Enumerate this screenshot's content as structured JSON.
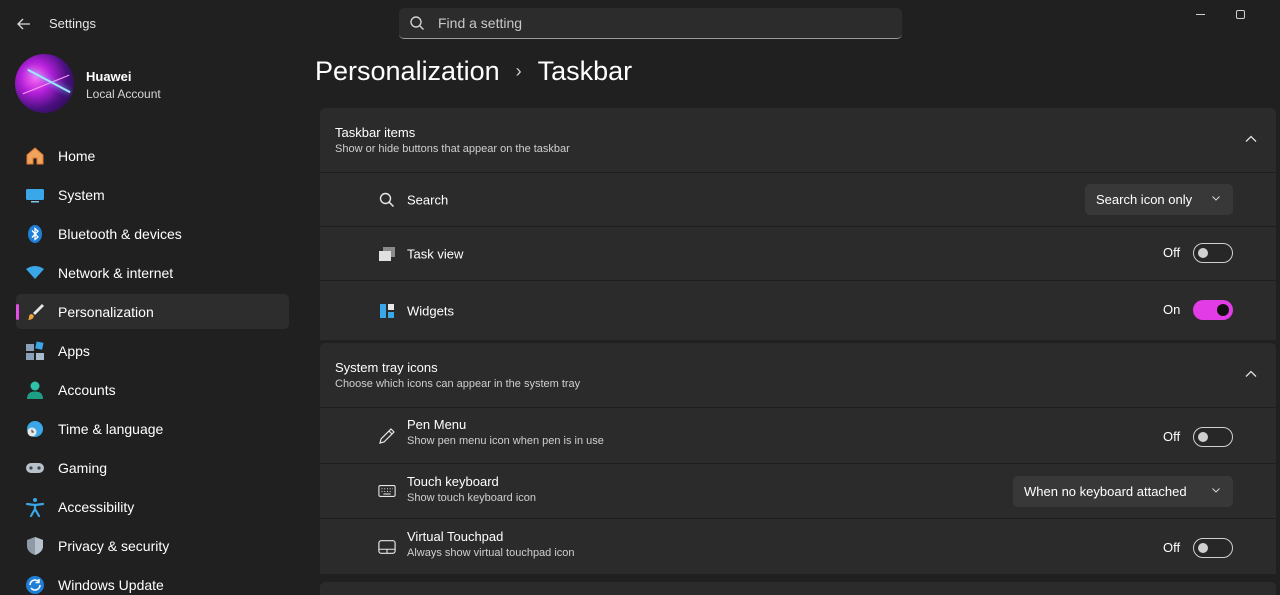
{
  "window": {
    "title": "Settings",
    "search_placeholder": "Find a setting"
  },
  "profile": {
    "name": "Huawei",
    "account_type": "Local Account"
  },
  "sidebar": {
    "items": [
      {
        "label": "Home",
        "icon": "home-icon"
      },
      {
        "label": "System",
        "icon": "system-icon"
      },
      {
        "label": "Bluetooth & devices",
        "icon": "bluetooth-icon"
      },
      {
        "label": "Network & internet",
        "icon": "wifi-icon"
      },
      {
        "label": "Personalization",
        "icon": "brush-icon",
        "active": true
      },
      {
        "label": "Apps",
        "icon": "apps-icon"
      },
      {
        "label": "Accounts",
        "icon": "accounts-icon"
      },
      {
        "label": "Time & language",
        "icon": "globe-clock-icon"
      },
      {
        "label": "Gaming",
        "icon": "gamepad-icon"
      },
      {
        "label": "Accessibility",
        "icon": "accessibility-icon"
      },
      {
        "label": "Privacy & security",
        "icon": "shield-icon"
      },
      {
        "label": "Windows Update",
        "icon": "update-icon"
      }
    ]
  },
  "breadcrumb": {
    "parent": "Personalization",
    "separator": "›",
    "current": "Taskbar"
  },
  "taskbar_items": {
    "title": "Taskbar items",
    "subtitle": "Show or hide buttons that appear on the taskbar",
    "search": {
      "label": "Search",
      "value": "Search icon only"
    },
    "task_view": {
      "label": "Task view",
      "state": "Off"
    },
    "widgets": {
      "label": "Widgets",
      "state": "On"
    }
  },
  "system_tray": {
    "title": "System tray icons",
    "subtitle": "Choose which icons can appear in the system tray",
    "pen_menu": {
      "label": "Pen Menu",
      "description": "Show pen menu icon when pen is in use",
      "state": "Off"
    },
    "touch_keyboard": {
      "label": "Touch keyboard",
      "description": "Show touch keyboard icon",
      "value": "When no keyboard attached"
    },
    "virtual_touchpad": {
      "label": "Virtual Touchpad",
      "description": "Always show virtual touchpad icon",
      "state": "Off"
    }
  },
  "colors": {
    "accent": "#e23ce6",
    "background": "#202020",
    "card": "#2b2b2b"
  }
}
